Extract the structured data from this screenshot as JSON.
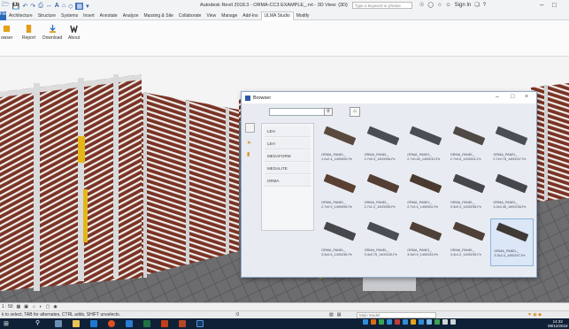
{
  "app": {
    "title": "Autodesk Revit 2018.3 -   ORMA-CC3 EXAMPLE_.rvt - 3D View: {3D}",
    "search_placeholder": "Type a keyword or phrase",
    "sign_in": "Sign In"
  },
  "ribbon_tabs": [
    "File",
    "Architecture",
    "Structure",
    "Systems",
    "Insert",
    "Annotate",
    "Analyze",
    "Massing & Site",
    "Collaborate",
    "View",
    "Manage",
    "Add-Ins",
    "ULMA Studio",
    "Modify"
  ],
  "active_tab": "ULMA Studio",
  "ribbon_buttons": [
    "owser",
    "Report",
    "Download",
    "About"
  ],
  "browser": {
    "title": "Browser",
    "categories": [
      "LEH",
      "LEH",
      "MEGAFORM",
      "MEGALITE",
      "ORMA"
    ],
    "items": [
      {
        "line1": "ORMA_PANEL_",
        "line2": "1.2x2.4_1400005-Fe",
        "color": "#5a4a3e"
      },
      {
        "line1": "ORMA_PANEL_",
        "line2": "2.7x0.3_1400006-Fe",
        "color": "#4a4d52"
      },
      {
        "line1": "ORMA_PANEL_",
        "line2": "2.7x0.45_1400010-Fe",
        "color": "#4a4d52"
      },
      {
        "line1": "ORMA_PANEL_",
        "line2": "2.7x0.6_1400011-Fe",
        "color": "#4f4a45"
      },
      {
        "line1": "ORMA_PANEL_",
        "line2": "2.7x0.75_1400047-Fe",
        "color": "#4a4d52"
      },
      {
        "line1": "ORMA_PANEL_",
        "line2": "2.7x0.9_1400008-Fe",
        "color": "#5a4033"
      },
      {
        "line1": "ORMA_PANEL_",
        "line2": "2.7x1.2_1400005-Fe",
        "color": "#553e33"
      },
      {
        "line1": "ORMA_PANEL_",
        "line2": "2.7x2.4_1400002-Fe",
        "color": "#4a3a30"
      },
      {
        "line1": "ORMA_PANEL_",
        "line2": "3.3x0.3_1400235-Fe",
        "color": "#45474b"
      },
      {
        "line1": "ORMA_PANEL_",
        "line2": "3.3x0.45_1400236-Fe",
        "color": "#45474b"
      },
      {
        "line1": "ORMA_PANEL_",
        "line2": "3.3x0.6_1400238-Fe",
        "color": "#45474b"
      },
      {
        "line1": "ORMA_PANEL_",
        "line2": "3.3x0.75_1400240-Fe",
        "color": "#4a4d52"
      },
      {
        "line1": "ORMA_PANEL_",
        "line2": "3.3x0.9_1400233-Fe",
        "color": "#4f4038"
      },
      {
        "line1": "ORMA_PANEL_",
        "line2": "3.3x1.2_1400235-Fe",
        "color": "#4f4038"
      },
      {
        "line1": "ORMA_PANEL_",
        "line2": "3.3x2.4_1400247-Fe",
        "color": "#3f3a36",
        "selected": true
      }
    ]
  },
  "viewbar": {
    "scale": "1 : 50"
  },
  "status": {
    "message": "k to select, TAB for alternates, CTRL adds, SHIFT unselects.",
    "zero": ":0",
    "model": "Main Model"
  },
  "clock": {
    "time": "14:32",
    "date": "08/12/2018"
  }
}
